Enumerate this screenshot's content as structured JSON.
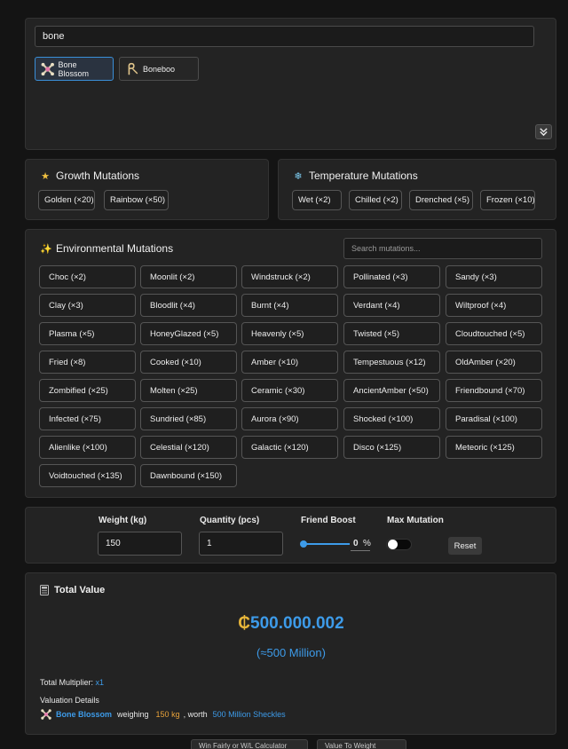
{
  "search": {
    "value": "bone"
  },
  "plants": [
    {
      "name": "Bone Blossom",
      "icon": "bone-blossom-icon",
      "selected": true
    },
    {
      "name": "Boneboo",
      "icon": "boneboo-icon",
      "selected": false
    }
  ],
  "growth": {
    "title": "Growth Mutations",
    "icon": "star-icon",
    "items": [
      "Golden (×20)",
      "Rainbow (×50)"
    ]
  },
  "temperature": {
    "title": "Temperature Mutations",
    "icon": "snowflake-icon",
    "items": [
      "Wet (×2)",
      "Chilled (×2)",
      "Drenched (×5)",
      "Frozen (×10)"
    ]
  },
  "environmental": {
    "title": "Environmental Mutations",
    "icon": "sparkles-icon",
    "search_placeholder": "Search mutations...",
    "items": [
      "Choc (×2)",
      "Moonlit (×2)",
      "Windstruck (×2)",
      "Pollinated (×3)",
      "Sandy (×3)",
      "Clay (×3)",
      "Bloodlit (×4)",
      "Burnt (×4)",
      "Verdant (×4)",
      "Wiltproof (×4)",
      "Plasma (×5)",
      "HoneyGlazed (×5)",
      "Heavenly (×5)",
      "Twisted (×5)",
      "Cloudtouched (×5)",
      "Fried (×8)",
      "Cooked (×10)",
      "Amber (×10)",
      "Tempestuous (×12)",
      "OldAmber (×20)",
      "Zombified (×25)",
      "Molten (×25)",
      "Ceramic (×30)",
      "AncientAmber (×50)",
      "Friendbound (×70)",
      "Infected (×75)",
      "Sundried (×85)",
      "Aurora (×90)",
      "Shocked (×100)",
      "Paradisal (×100)",
      "Alienlike (×100)",
      "Celestial (×120)",
      "Galactic (×120)",
      "Disco (×125)",
      "Meteoric (×125)",
      "Voidtouched (×135)",
      "Dawnbound (×150)"
    ]
  },
  "controls": {
    "weight_label": "Weight (kg)",
    "weight_value": "150",
    "quantity_label": "Quantity (pcs)",
    "quantity_value": "1",
    "friend_label": "Friend Boost",
    "friend_value": "0",
    "friend_unit": "%",
    "max_label": "Max Mutation",
    "max_on": false,
    "reset_label": "Reset"
  },
  "total": {
    "title": "Total Value",
    "icon": "calculator-icon",
    "currency": "₵",
    "value": "500.000.002",
    "approx": "(≈500 Million)",
    "multiplier_label": "Total Multiplier:",
    "multiplier_value": "x1",
    "details_label": "Valuation Details",
    "detail_plant": "Bone Blossom",
    "detail_weighing": "weighing",
    "detail_weight": "150 kg",
    "detail_worth": ", worth",
    "detail_value": "500 Million Sheckles"
  },
  "bottom_tabs": [
    "Win Fairly or W/L Calculator",
    "Value To Weight"
  ],
  "colors": {
    "accent": "#3d9be9",
    "gold": "#e8b63a",
    "weight": "#e8a23a",
    "panel": "#232323",
    "background": "#141414"
  }
}
